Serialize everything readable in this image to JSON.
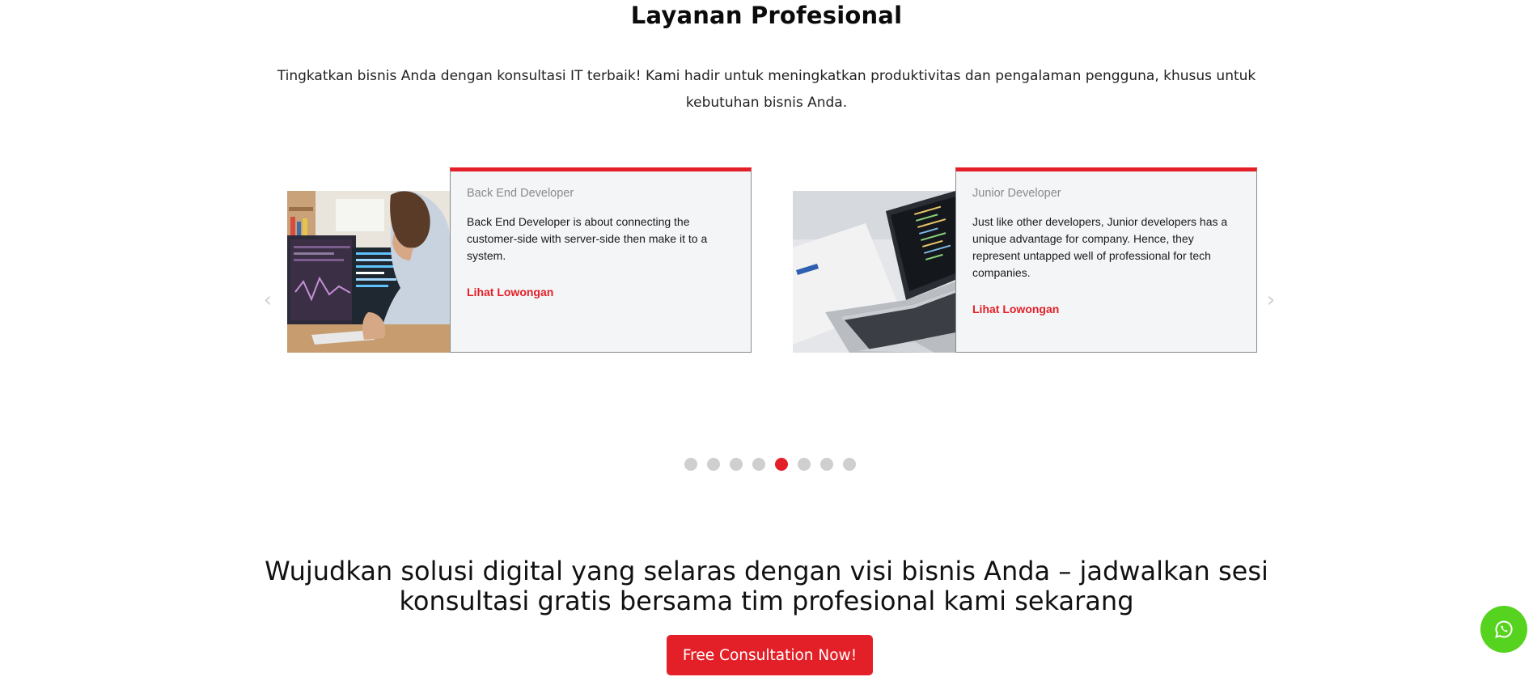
{
  "section": {
    "title": "Layanan Profesional",
    "description": "Tingkatkan bisnis Anda dengan konsultasi IT terbaik! Kami hadir untuk meningkatkan produktivitas dan pengalaman pengguna, khusus untuk kebutuhan bisnis Anda."
  },
  "carousel": {
    "prev_icon": "chevron-left-icon",
    "next_icon": "chevron-right-icon",
    "cards": [
      {
        "title": "Back End Developer",
        "text": "Back End Developer is about connecting the customer-side with server-side then make it to a system.",
        "link": "Lihat Lowongan",
        "image": "developer-at-monitors-photo"
      },
      {
        "title": "Junior Developer",
        "text": "Just like other developers, Junior developers has a unique advantage for company. Hence, they represent untapped well of professional for tech companies.",
        "link": "Lihat Lowongan",
        "image": "laptop-with-code-photo"
      }
    ],
    "dots": {
      "count": 8,
      "active_index": 5
    }
  },
  "cta": {
    "heading": "Wujudkan solusi digital yang selaras dengan visi bisnis Anda – jadwalkan sesi konsultasi gratis bersama tim profesional kami sekarang",
    "button": "Free Consultation Now!"
  },
  "whatsapp": {
    "icon": "whatsapp-icon"
  },
  "colors": {
    "accent": "#e32028",
    "whatsapp": "#56d31f",
    "dot_inactive": "#cfcfcf",
    "card_bg": "#f4f5f7"
  }
}
